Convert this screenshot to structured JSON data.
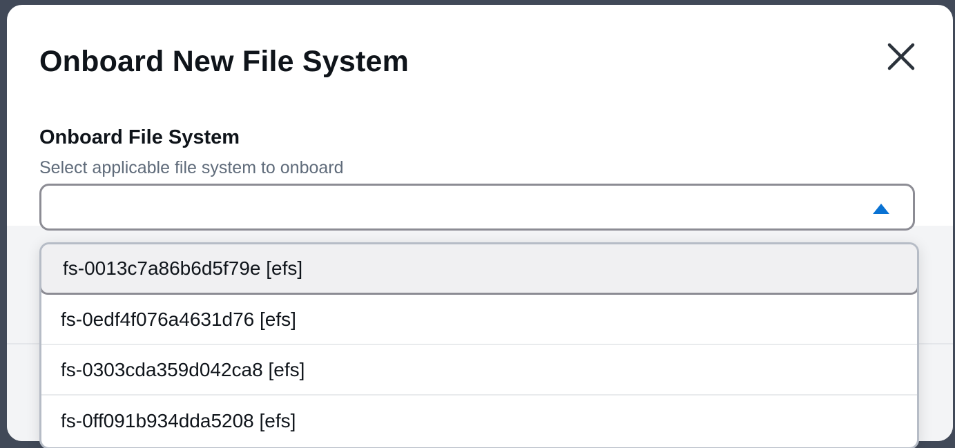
{
  "modal": {
    "title": "Onboard New File System",
    "close_icon": "close-icon"
  },
  "field": {
    "label": "Onboard File System",
    "description": "Select applicable file system to onboard",
    "selected_value": "",
    "caret_icon": "caret-up-icon",
    "accent_color": "#0972d3"
  },
  "dropdown": {
    "options": [
      {
        "label": "fs-0013c7a86b6d5f79e [efs]",
        "highlighted": true
      },
      {
        "label": "fs-0edf4f076a4631d76 [efs]",
        "highlighted": false
      },
      {
        "label": "fs-0303cda359d042ca8 [efs]",
        "highlighted": false
      },
      {
        "label": "fs-0ff091b934dda5208 [efs]",
        "highlighted": false
      }
    ]
  }
}
